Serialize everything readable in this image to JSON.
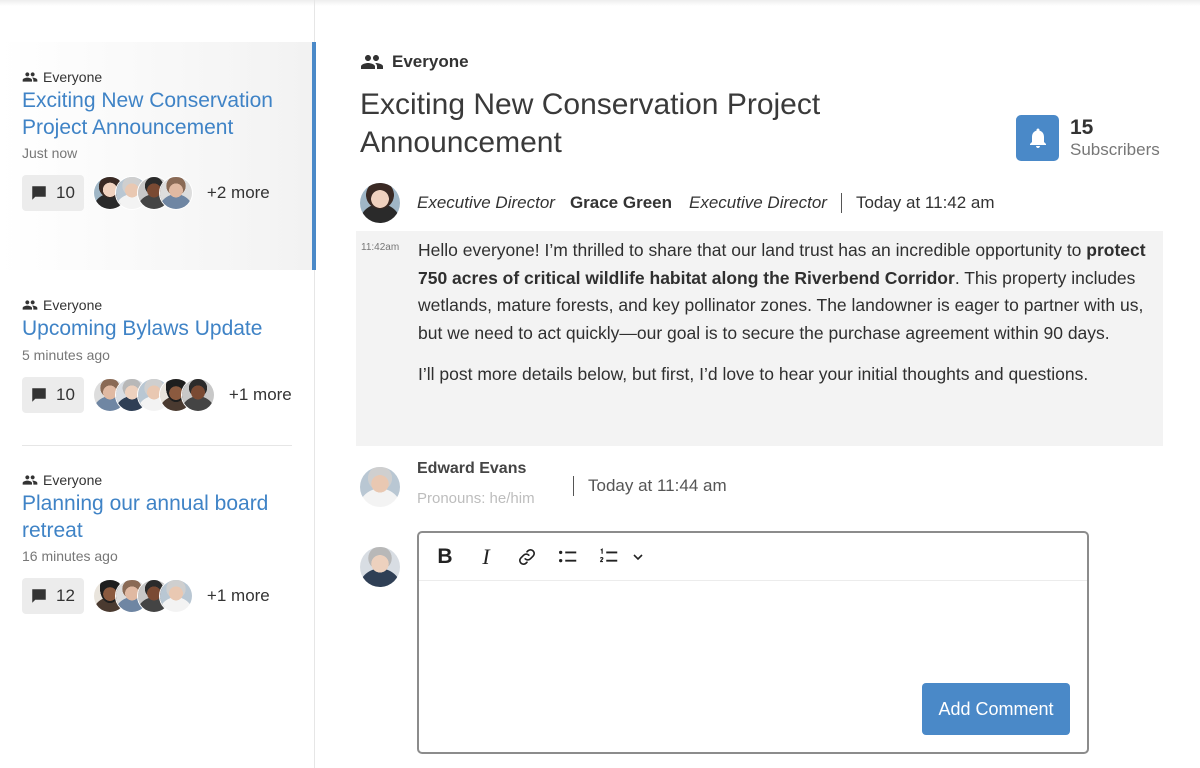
{
  "sidebar": {
    "threads": [
      {
        "audience": "Everyone",
        "title": "Exciting New Conservation Project Announcement",
        "time": "Just now",
        "comments": "10",
        "more": "+2 more",
        "active": true
      },
      {
        "audience": "Everyone",
        "title": "Upcoming Bylaws Update",
        "time": "5 minutes ago",
        "comments": "10",
        "more": "+1 more"
      },
      {
        "audience": "Everyone",
        "title": "Planning our annual board retreat",
        "time": "16 minutes ago",
        "comments": "12",
        "more": "+1 more"
      }
    ]
  },
  "main": {
    "audience": "Everyone",
    "title": "Exciting New Conservation Project Announcement",
    "subscribers": {
      "count": "15",
      "label": "Subscribers"
    },
    "post": {
      "role_before": "Executive Director",
      "author": "Grace Green",
      "role_after": "Executive Director",
      "time": "Today at 11:42 am",
      "short_time": "11:42am",
      "para1_a": "Hello everyone! I’m thrilled to share that our land trust has an incredible opportunity to ",
      "para1_bold": "protect 750 acres of critical wildlife habitat along the Riverbend Corridor",
      "para1_b": ". This property includes wetlands, mature forests, and key pollinator zones. The landowner is eager to partner with us, but we need to act quickly—our goal is to secure the purchase agreement within 90 days.",
      "para2": "I’ll post more details below, but first, I’d love to hear your initial thoughts and questions."
    },
    "reply": {
      "author": "Edward Evans",
      "pronouns": "Pronouns: he/him",
      "time": "Today at 11:44 am"
    },
    "editor": {
      "bold_label": "B",
      "italic_label": "I",
      "add_comment_label": "Add Comment"
    }
  },
  "colors": {
    "accent": "#4a89c8",
    "link": "#3f83c6"
  },
  "icons": [
    "people-icon",
    "comment-icon",
    "bell-icon",
    "link-icon",
    "bullet-list-icon",
    "numbered-list-icon",
    "chevron-down-icon"
  ]
}
